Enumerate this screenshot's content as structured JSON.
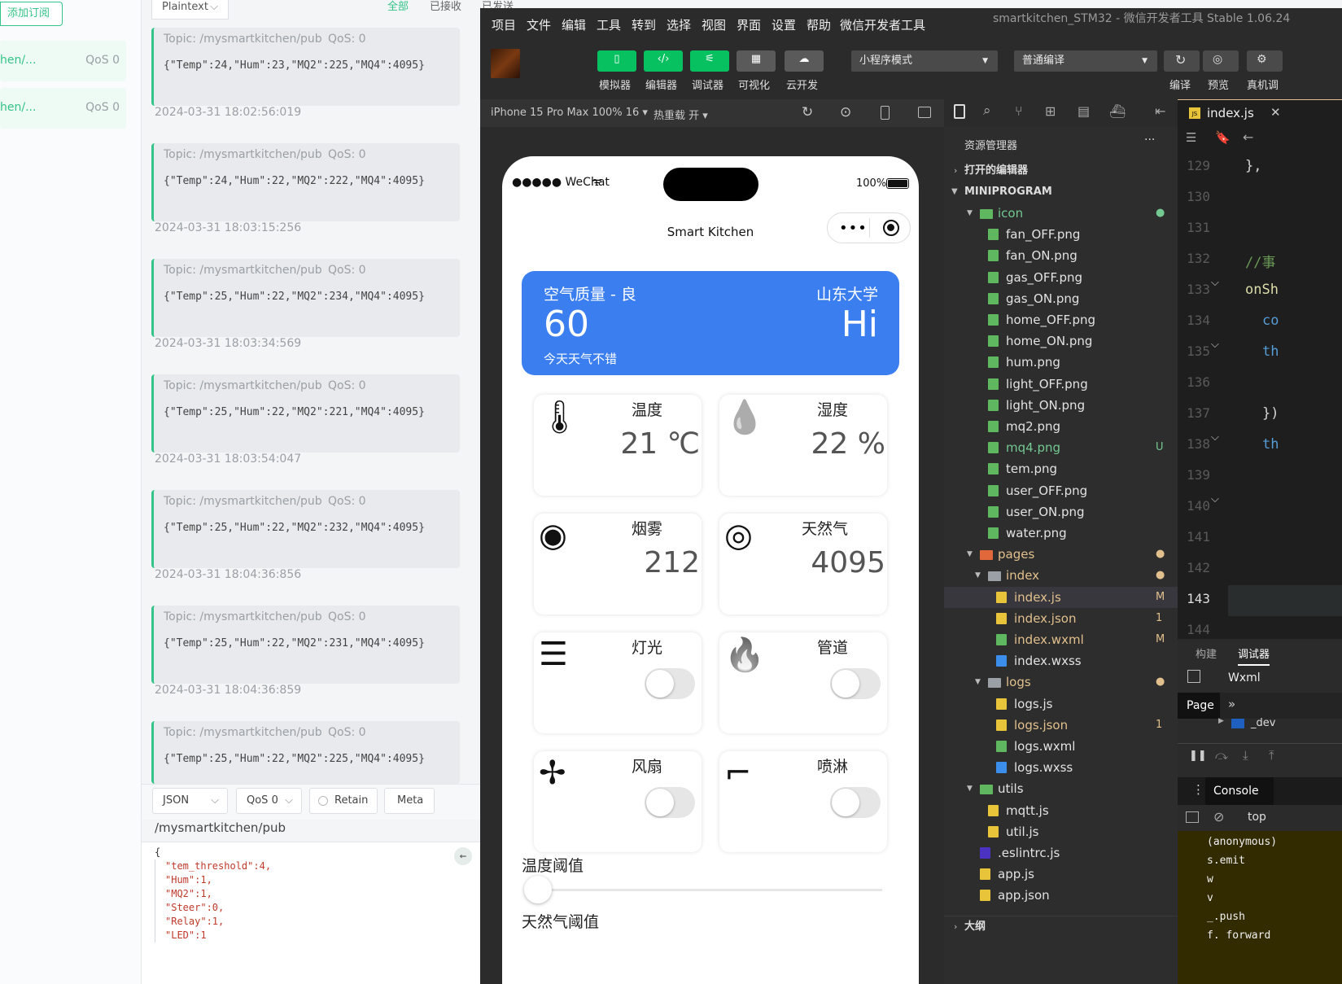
{
  "mqtt": {
    "add_sub_label": "添加订阅",
    "subscriptions": [
      {
        "topic": "hen/...",
        "qos": "QoS 0"
      },
      {
        "topic": "hen/...",
        "qos": "QoS 0"
      }
    ],
    "format_label": "Plaintext",
    "filters": [
      "全部",
      "已接收",
      "已发送"
    ],
    "messages": [
      {
        "topic": "Topic: /mysmartkitchen/pub",
        "qos": "QoS: 0",
        "payload": "{\"Temp\":24,\"Hum\":23,\"MQ2\":225,\"MQ4\":4095}",
        "time": "2024-03-31 18:02:56:019"
      },
      {
        "topic": "Topic: /mysmartkitchen/pub",
        "qos": "QoS: 0",
        "payload": "{\"Temp\":24,\"Hum\":22,\"MQ2\":222,\"MQ4\":4095}",
        "time": "2024-03-31 18:03:15:256"
      },
      {
        "topic": "Topic: /mysmartkitchen/pub",
        "qos": "QoS: 0",
        "payload": "{\"Temp\":25,\"Hum\":22,\"MQ2\":234,\"MQ4\":4095}",
        "time": "2024-03-31 18:03:34:569"
      },
      {
        "topic": "Topic: /mysmartkitchen/pub",
        "qos": "QoS: 0",
        "payload": "{\"Temp\":25,\"Hum\":22,\"MQ2\":221,\"MQ4\":4095}",
        "time": "2024-03-31 18:03:54:047"
      },
      {
        "topic": "Topic: /mysmartkitchen/pub",
        "qos": "QoS: 0",
        "payload": "{\"Temp\":25,\"Hum\":22,\"MQ2\":232,\"MQ4\":4095}",
        "time": "2024-03-31 18:04:36:856"
      },
      {
        "topic": "Topic: /mysmartkitchen/pub",
        "qos": "QoS: 0",
        "payload": "{\"Temp\":25,\"Hum\":22,\"MQ2\":231,\"MQ4\":4095}",
        "time": "2024-03-31 18:04:36:859"
      },
      {
        "topic": "Topic: /mysmartkitchen/pub",
        "qos": "QoS: 0",
        "payload": "{\"Temp\":25,\"Hum\":22,\"MQ2\":225,\"MQ4\":4095}",
        "time": ""
      }
    ],
    "publish": {
      "format": "JSON",
      "qos": "QoS 0",
      "retain": "Retain",
      "meta": "Meta",
      "topic": "/mysmartkitchen/pub",
      "body": [
        "{",
        "\"tem_threshold\":4,",
        "\"Hum\":1,",
        "\"MQ2\":1,",
        "\"Steer\":0,",
        "\"Relay\":1,",
        "\"LED\":1"
      ]
    }
  },
  "devtools": {
    "menu": [
      "项目",
      "文件",
      "编辑",
      "工具",
      "转到",
      "选择",
      "视图",
      "界面",
      "设置",
      "帮助",
      "微信开发者工具"
    ],
    "window_title": "smartkitchen_STM32 - 微信开发者工具 Stable 1.06.24",
    "toolbar": [
      "模拟器",
      "编辑器",
      "调试器",
      "可视化",
      "云开发"
    ],
    "mode_select": "小程序模式",
    "compile_select": "普通编译",
    "right_tools": [
      "编译",
      "预览",
      "真机调"
    ],
    "device": "iPhone 15 Pro Max 100% 16 ▾",
    "hot_reload": "热重载 开 ▾",
    "colors": {
      "accent_green": "#07c160",
      "blue_card": "#3a7ef0",
      "mqtt_green": "#34c388"
    }
  },
  "phone": {
    "carrier": "●●●●● WeChat",
    "battery": "100%",
    "title": "Smart Kitchen",
    "card": {
      "quality": "空气质量 - 良",
      "location": "山东大学",
      "value": "60",
      "greeting": "Hi",
      "sub": "今天天气不错"
    },
    "tiles": [
      {
        "name": "温度",
        "value": "21 ℃",
        "icon": "thermometer-icon"
      },
      {
        "name": "湿度",
        "value": "22 %",
        "icon": "water-drop-icon"
      },
      {
        "name": "烟雾",
        "value": "212",
        "icon": "smoke-detector-icon"
      },
      {
        "name": "天然气",
        "value": "4095",
        "icon": "gas-sensor-icon"
      },
      {
        "name": "灯光",
        "icon": "light-icon",
        "on": false
      },
      {
        "name": "管道",
        "icon": "fire-icon",
        "on": false
      },
      {
        "name": "风扇",
        "icon": "fan-icon",
        "on": false
      },
      {
        "name": "喷淋",
        "icon": "sprinkler-icon",
        "on": false
      }
    ],
    "slider1_label": "温度阈值",
    "slider2_label": "天然气阈值"
  },
  "explorer": {
    "title": "资源管理器",
    "more": "···",
    "open_editors": "打开的编辑器",
    "root": "MINIPROGRAM",
    "outline": "大纲",
    "rows": [
      {
        "label": "icon",
        "type": "folder-green",
        "depth": 1,
        "status": "●",
        "color": "#73c991"
      },
      {
        "label": "fan_OFF.png",
        "type": "img",
        "depth": 2
      },
      {
        "label": "fan_ON.png",
        "type": "img",
        "depth": 2
      },
      {
        "label": "gas_OFF.png",
        "type": "img",
        "depth": 2
      },
      {
        "label": "gas_ON.png",
        "type": "img",
        "depth": 2
      },
      {
        "label": "home_OFF.png",
        "type": "img",
        "depth": 2
      },
      {
        "label": "home_ON.png",
        "type": "img",
        "depth": 2
      },
      {
        "label": "hum.png",
        "type": "img",
        "depth": 2
      },
      {
        "label": "light_OFF.png",
        "type": "img",
        "depth": 2
      },
      {
        "label": "light_ON.png",
        "type": "img",
        "depth": 2
      },
      {
        "label": "mq2.png",
        "type": "img",
        "depth": 2
      },
      {
        "label": "mq4.png",
        "type": "img",
        "depth": 2,
        "status": "U",
        "color": "#73c991"
      },
      {
        "label": "tem.png",
        "type": "img",
        "depth": 2
      },
      {
        "label": "user_OFF.png",
        "type": "img",
        "depth": 2
      },
      {
        "label": "user_ON.png",
        "type": "img",
        "depth": 2
      },
      {
        "label": "water.png",
        "type": "img",
        "depth": 2
      },
      {
        "label": "pages",
        "type": "folder-red",
        "depth": 1,
        "status": "●",
        "color": "#e2c08d"
      },
      {
        "label": "index",
        "type": "folder",
        "depth": 2,
        "status": "●",
        "color": "#e2c08d"
      },
      {
        "label": "index.js",
        "type": "js",
        "depth": 3,
        "status": "M",
        "color": "#e2c08d",
        "selected": true
      },
      {
        "label": "index.json",
        "type": "json",
        "depth": 3,
        "status": "1",
        "color": "#e2c08d"
      },
      {
        "label": "index.wxml",
        "type": "wxml",
        "depth": 3,
        "status": "M",
        "color": "#e2c08d"
      },
      {
        "label": "index.wxss",
        "type": "wxss",
        "depth": 3
      },
      {
        "label": "logs",
        "type": "folder",
        "depth": 2,
        "status": "●",
        "color": "#e2c08d"
      },
      {
        "label": "logs.js",
        "type": "js",
        "depth": 3
      },
      {
        "label": "logs.json",
        "type": "json",
        "depth": 3,
        "status": "1",
        "color": "#e2c08d"
      },
      {
        "label": "logs.wxml",
        "type": "wxml",
        "depth": 3
      },
      {
        "label": "logs.wxss",
        "type": "wxss",
        "depth": 3
      },
      {
        "label": "utils",
        "type": "folder-green",
        "depth": 1
      },
      {
        "label": "mqtt.js",
        "type": "js",
        "depth": 2
      },
      {
        "label": "util.js",
        "type": "js",
        "depth": 2
      },
      {
        "label": ".eslintrc.js",
        "type": "eslint",
        "depth": 1
      },
      {
        "label": "app.js",
        "type": "js",
        "depth": 1
      },
      {
        "label": "app.json",
        "type": "json",
        "depth": 1
      }
    ]
  },
  "editor": {
    "tab": "index.js",
    "lines": [
      "129",
      "130",
      "131",
      "132",
      "133",
      "134",
      "135",
      "136",
      "137",
      "138",
      "139",
      "140",
      "141",
      "142",
      "143",
      "144"
    ],
    "code": [
      {
        "t": "},",
        "c": "#d4d4d4"
      },
      {
        "t": "//事",
        "c": "#6a9955"
      },
      {
        "t": "onSh",
        "c": "#dcdcaa"
      },
      {
        "t": "co",
        "c": "#569cd6"
      },
      {
        "t": "th",
        "c": "#569cd6"
      },
      {
        "t": "})",
        "c": "#d4d4d4"
      },
      {
        "t": "th",
        "c": "#569cd6"
      }
    ],
    "debug_tabs": [
      "构建",
      "调试器"
    ],
    "wxml_tab": "Wxml",
    "page_label": "Page",
    "dev_label": "_dev",
    "console_tab": "Console",
    "top_label": "top",
    "stack": [
      "(anonymous)",
      "s.emit",
      "w",
      "v",
      "_.push",
      "f. forward"
    ]
  }
}
